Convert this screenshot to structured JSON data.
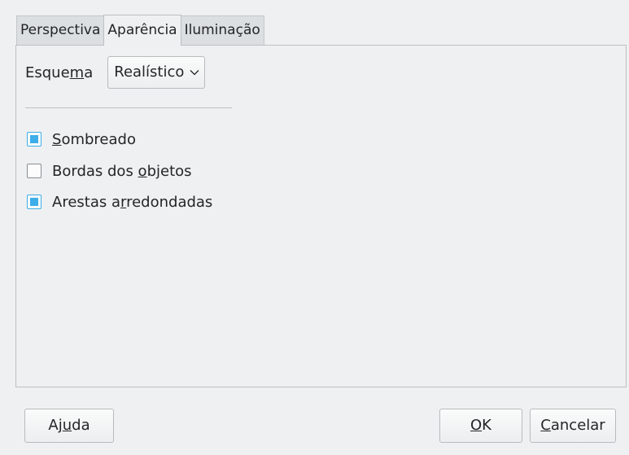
{
  "tabs": [
    {
      "label": "Perspectiva",
      "active": false
    },
    {
      "label": "Aparência",
      "active": true
    },
    {
      "label": "Iluminação",
      "active": false
    }
  ],
  "scheme": {
    "label_before": "Esque",
    "label_mnemonic": "m",
    "label_after": "a",
    "value": "Realístico",
    "arrow_icon": "chevron-down-icon"
  },
  "options": [
    {
      "before": "",
      "mnemonic": "S",
      "after": "ombreado",
      "checked": true
    },
    {
      "before": "Bordas dos ",
      "mnemonic": "o",
      "after": "bjetos",
      "checked": false
    },
    {
      "before": "Arestas a",
      "mnemonic": "r",
      "after": "redondadas",
      "checked": true
    }
  ],
  "buttons": {
    "help": {
      "before": "Aj",
      "mnemonic": "u",
      "after": "da"
    },
    "ok": {
      "before": "",
      "mnemonic": "O",
      "after": "K"
    },
    "cancel": {
      "before": "",
      "mnemonic": "C",
      "after": "ancelar"
    }
  },
  "colors": {
    "accent": "#3daee9",
    "background": "#eff0f1"
  }
}
